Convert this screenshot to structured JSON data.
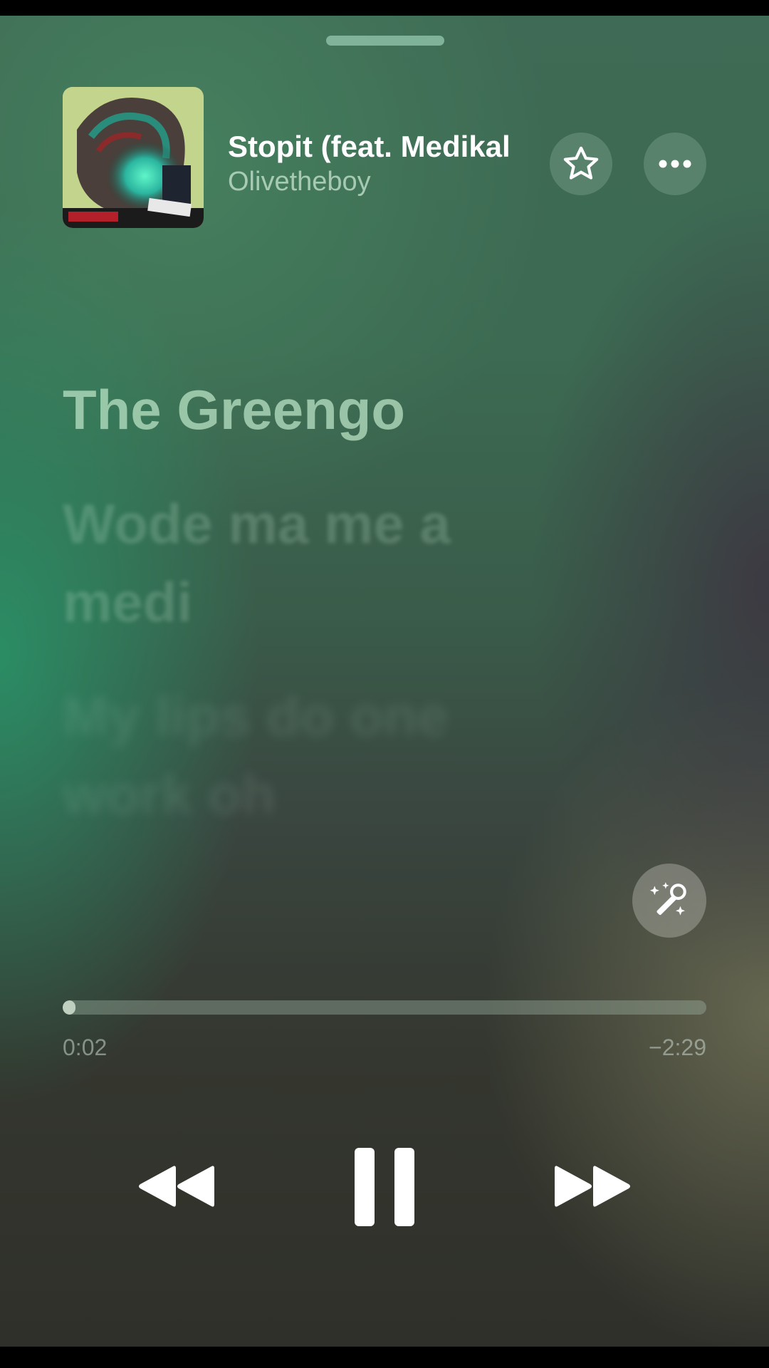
{
  "now_playing": {
    "title": "Stopit (feat. Medikal",
    "artist": "Olivetheboy",
    "artwork_icon": "album-artwork"
  },
  "actions": {
    "favorite_icon": "star-icon",
    "more_icon": "ellipsis-icon"
  },
  "lyrics": {
    "lines": [
      "The Greengo",
      "Wode ma me a medi",
      "My lips do one work oh",
      ""
    ]
  },
  "lyrics_mode_icon": "microphone-sparkle-icon",
  "progress": {
    "elapsed": "0:02",
    "remaining": "−2:29",
    "fraction": 0.013
  },
  "controls": {
    "previous_icon": "rewind-icon",
    "playpause_icon": "pause-icon",
    "next_icon": "fast-forward-icon"
  },
  "colors": {
    "accent_green": "#2f9a6b",
    "background_dark": "#2f302a"
  }
}
